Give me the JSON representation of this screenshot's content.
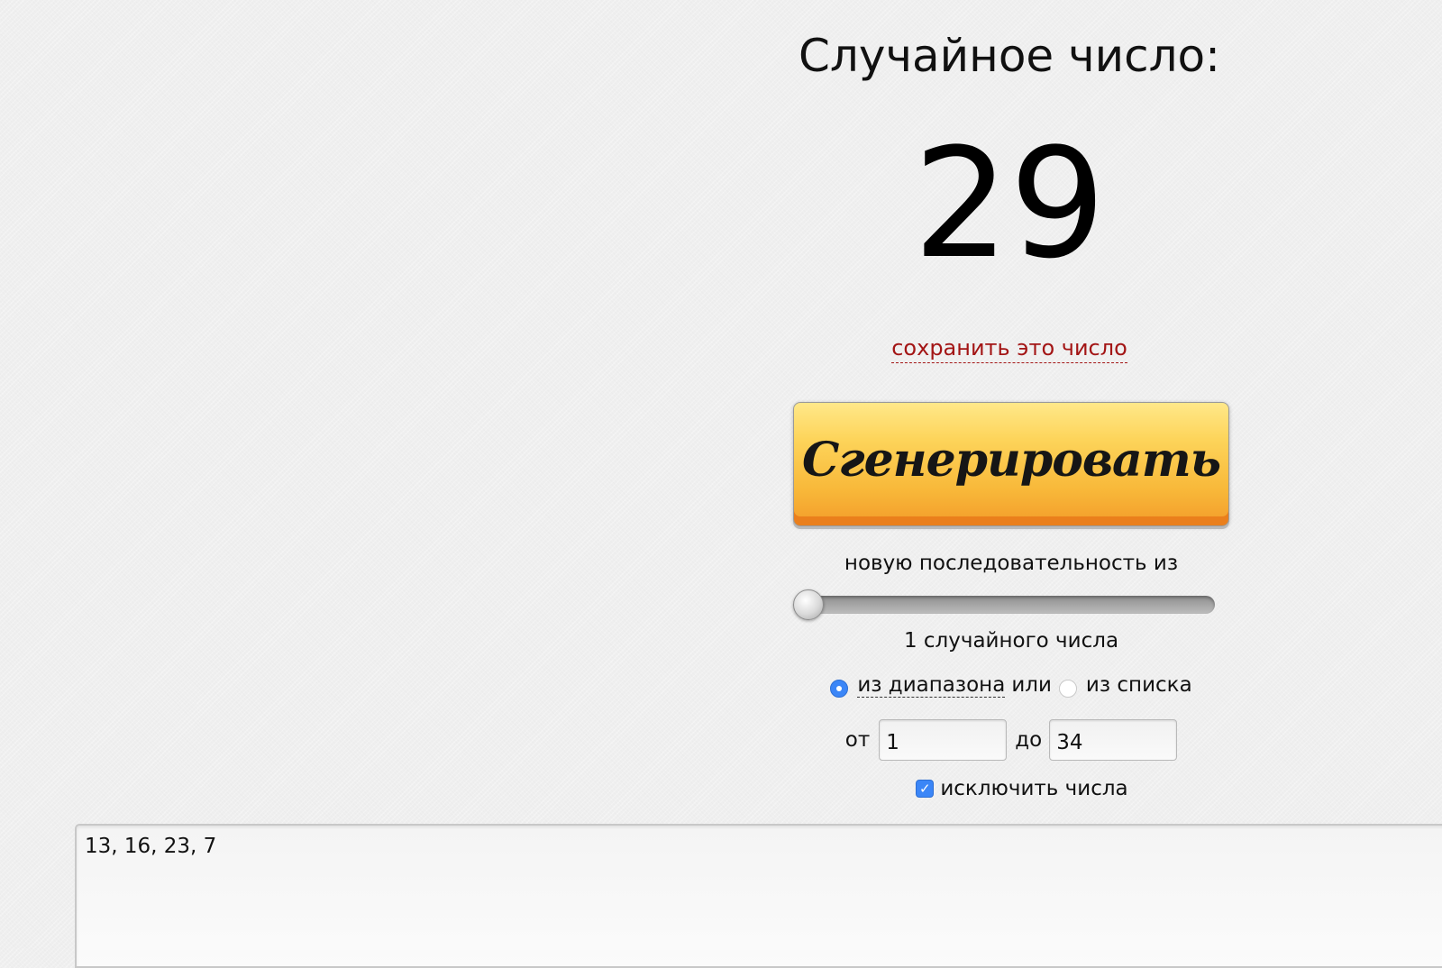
{
  "heading": "Случайное число:",
  "result": "29",
  "save_link": "сохранить это число",
  "generate_button": "Сгенерировать",
  "sequence_label": "новую последовательность из",
  "count_slider": {
    "value": 1,
    "fraction": 0.0
  },
  "count_label": "1 случайного числа",
  "mode": {
    "range_label": "из диапазона",
    "or_text": "или",
    "list_label": "из списка",
    "selected": "range"
  },
  "range": {
    "from_label": "от",
    "from_value": "1",
    "to_label": "до",
    "to_value": "34"
  },
  "exclude": {
    "label": "исключить числа",
    "checked": true,
    "values": "13, 16, 23, 7"
  },
  "colors": {
    "link": "#a31515",
    "accent": "#3b86f7",
    "button_top": "#ffe889",
    "button_bottom": "#f39c2a"
  }
}
